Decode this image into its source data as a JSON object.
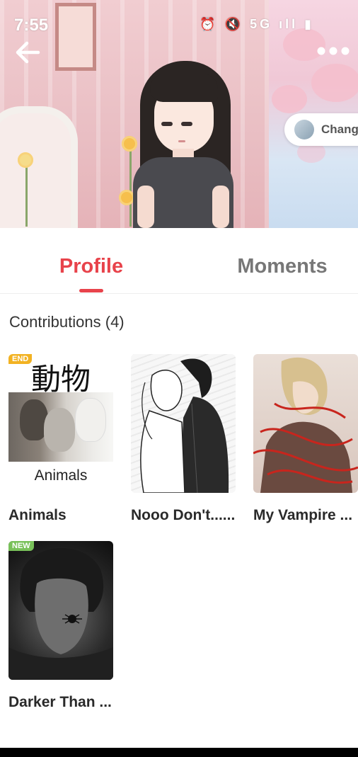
{
  "status_bar": {
    "time": "7:55",
    "icons": "⏰ 🔇 5G ıll ▮"
  },
  "header": {
    "change_label": "Chang"
  },
  "tabs": [
    {
      "label": "Profile",
      "active": true
    },
    {
      "label": "Moments",
      "active": false
    }
  ],
  "contributions": {
    "title": "Contributions (4)",
    "items": [
      {
        "title": "Animals",
        "badge": "END",
        "cover_kanji": "動物",
        "cover_caption": "Animals"
      },
      {
        "title": "Nooo Don't......",
        "badge": ""
      },
      {
        "title": "My Vampire ...",
        "badge": ""
      },
      {
        "title": "Darker Than ...",
        "badge": "NEW"
      }
    ]
  },
  "colors": {
    "accent": "#e8434b",
    "inactive_tab": "#777777",
    "badge_end": "#f2b222",
    "badge_new": "#79c15a"
  },
  "icons": {
    "back": "back-arrow-icon",
    "more": "more-dots-icon"
  }
}
